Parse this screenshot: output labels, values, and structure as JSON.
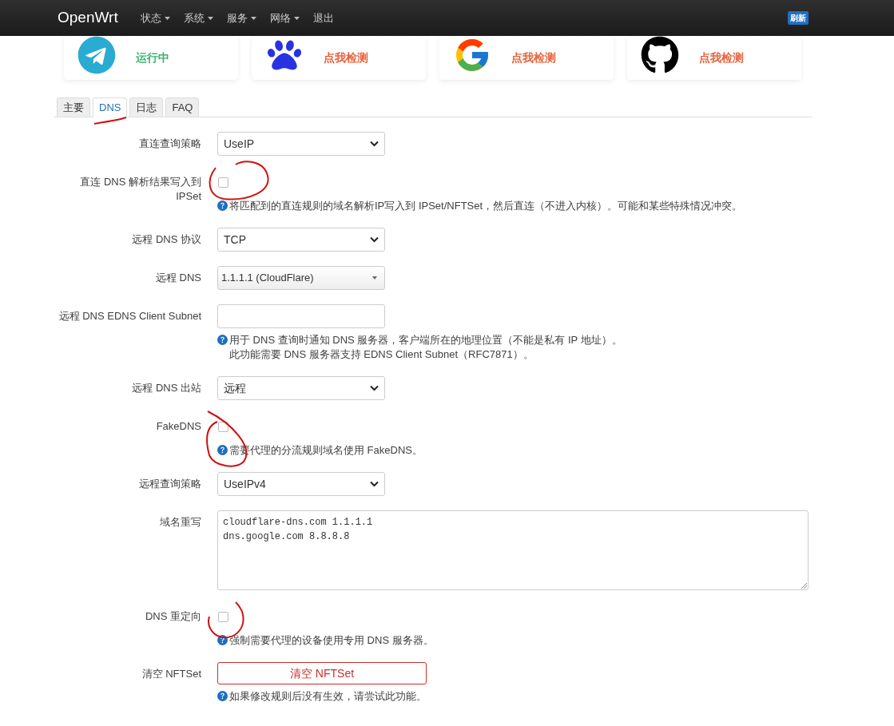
{
  "navbar": {
    "brand": "OpenWrt",
    "menu": [
      {
        "label": "状态",
        "dropdown": true
      },
      {
        "label": "系统",
        "dropdown": true
      },
      {
        "label": "服务",
        "dropdown": true
      },
      {
        "label": "网络",
        "dropdown": true
      },
      {
        "label": "退出",
        "dropdown": false
      }
    ],
    "badge": "刷新"
  },
  "cards": [
    {
      "status": "运行中",
      "color": "#3cb371"
    },
    {
      "status": "点我检测",
      "color": "#e8633c"
    },
    {
      "status": "点我检测",
      "color": "#e8633c"
    },
    {
      "status": "点我检测",
      "color": "#e8633c"
    }
  ],
  "tabs": [
    {
      "label": "主要",
      "selected": false
    },
    {
      "label": "DNS",
      "selected": true
    },
    {
      "label": "日志",
      "selected": false
    },
    {
      "label": "FAQ",
      "selected": false
    }
  ],
  "form": [
    {
      "kind": "select",
      "label": "直连查询策略",
      "value": "UseIP"
    },
    {
      "kind": "checkbox",
      "label": "直连 DNS 解析结果写入到 IPSet",
      "checked": false,
      "help": [
        "将匹配到的直连规则的域名解析IP写入到 IPSet/NFTSet，然后直连（不进入内核）。可能和某些特殊情况冲突。"
      ]
    },
    {
      "kind": "select",
      "label": "远程 DNS 协议",
      "value": "TCP"
    },
    {
      "kind": "combobox",
      "label": "远程 DNS",
      "value": "1.1.1.1 (CloudFlare)"
    },
    {
      "kind": "input",
      "label": "远程 DNS EDNS Client Subnet",
      "help": [
        "用于 DNS 查询时通知 DNS 服务器，客户端所在的地理位置（不能是私有 IP 地址）。",
        "此功能需要 DNS 服务器支持 EDNS Client Subnet（RFC7871）。"
      ]
    },
    {
      "kind": "select",
      "label": "远程 DNS 出站",
      "value": "远程"
    },
    {
      "kind": "checkbox",
      "label": "FakeDNS",
      "checked": false,
      "help": [
        "需要代理的分流规则域名使用 FakeDNS。"
      ]
    },
    {
      "kind": "select",
      "label": "远程查询策略",
      "value": "UseIPv4"
    },
    {
      "kind": "textarea",
      "label": "域名重写",
      "lines": [
        "cloudflare-dns.com 1.1.1.1",
        "dns.google.com 8.8.8.8"
      ]
    },
    {
      "kind": "checkbox",
      "label": "DNS 重定向",
      "checked": false,
      "help": [
        "强制需要代理的设备使用专用 DNS 服务器。"
      ]
    },
    {
      "kind": "button",
      "label": "清空 NFTSet",
      "value": "清空 NFTSet",
      "help": [
        "如果修改规则后没有生效，请尝试此功能。"
      ]
    }
  ]
}
